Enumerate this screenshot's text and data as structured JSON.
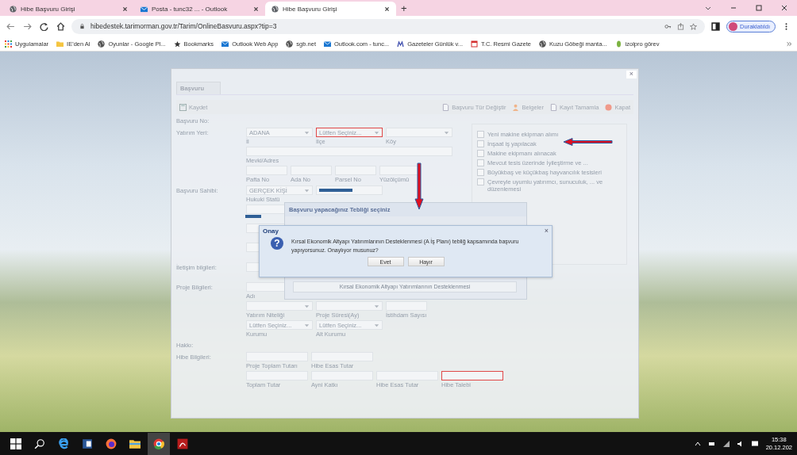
{
  "browser": {
    "tabs": [
      {
        "title": "Hibe Başvuru Girişi",
        "kind": "globe",
        "selected": false
      },
      {
        "title": "Posta - tunc32 ... - Outlook",
        "kind": "mail",
        "selected": false
      },
      {
        "title": "Hibe Başvuru Girişi",
        "kind": "globe",
        "selected": true
      }
    ],
    "new_tab": "+",
    "url": "hibedestek.tarimorman.gov.tr/Tarim/OnlineBasvuru.aspx?tip=3",
    "profile": "Duraklatıldı",
    "bookmarks": [
      {
        "label": "Uygulamalar",
        "kind": "apps"
      },
      {
        "label": "IE'den Al",
        "kind": "folder"
      },
      {
        "label": "Oyunlar - Google Pl...",
        "kind": "globe"
      },
      {
        "label": "Bookmarks",
        "kind": "star"
      },
      {
        "label": "Outlook Web App",
        "kind": "mail"
      },
      {
        "label": "sgb.net",
        "kind": "globe"
      },
      {
        "label": "Outlook.com - tunc...",
        "kind": "mail"
      },
      {
        "label": "Gazeteler Günlük v...",
        "kind": "paper"
      },
      {
        "label": "T.C. Resmi Gazete",
        "kind": "calendar"
      },
      {
        "label": "Kuzu Göbeği manta...",
        "kind": "globe"
      },
      {
        "label": "izolpro görev",
        "kind": "leaf"
      }
    ]
  },
  "form": {
    "close": "×",
    "tab": "Başvuru",
    "save": "Kaydet",
    "actions": [
      {
        "label": "Başvuru Tür Değiştir",
        "kind": "doc"
      },
      {
        "label": "Belgeler",
        "kind": "person"
      },
      {
        "label": "Kayıt Tamamla",
        "kind": "doc"
      },
      {
        "label": "Kapat",
        "kind": "stop"
      }
    ],
    "number_label": "Başvuru No:",
    "sections": [
      {
        "label": "Yatırım Yeri:",
        "lines": [
          {
            "fields": [
              {
                "kind": "select",
                "value": "ADANA",
                "caption": "İl",
                "error": false
              },
              {
                "kind": "select",
                "value": "Lütfen Seçiniz...",
                "caption": "İlçe",
                "error": true
              },
              {
                "kind": "select",
                "caption": "Köy",
                "error": false
              }
            ]
          },
          {
            "fields": [
              {
                "kind": "wide",
                "caption": "Mevki/Adres",
                "error": false
              }
            ]
          },
          {
            "fields": [
              {
                "kind": "text",
                "caption": "Pafta No",
                "error": false
              },
              {
                "kind": "text",
                "caption": "Ada No",
                "error": false
              },
              {
                "kind": "text",
                "caption": "Parsel No",
                "error": false
              },
              {
                "kind": "text",
                "caption": "Yüzölçümü",
                "error": false
              }
            ]
          }
        ]
      },
      {
        "label": "Başvuru Sahibi:",
        "lines": [
          {
            "fields": [
              {
                "kind": "select",
                "value": "GERÇEK KİŞİ",
                "caption": "Hukuki Statü",
                "error": false
              },
              {
                "kind": "redacted",
                "error": false
              }
            ]
          },
          {
            "fields": [
              {
                "kind": "select",
                "error": false
              }
            ]
          },
          {
            "fields": [
              {
                "kind": "select",
                "error": false
              }
            ]
          },
          {
            "fields": [
              {
                "kind": "select",
                "error": false
              }
            ]
          }
        ]
      },
      {
        "label": "İletişim bilgileri:",
        "lines": [
          {
            "fields": [
              {
                "kind": "select",
                "error": false
              }
            ]
          }
        ]
      },
      {
        "label": "Proje Bilgileri:",
        "lines": [
          {
            "fields": [
              {
                "kind": "text",
                "caption": "Adı",
                "error": false
              }
            ]
          },
          {
            "fields": [
              {
                "kind": "select",
                "caption": "Yatırım Niteliği",
                "error": false
              },
              {
                "kind": "select",
                "caption": "Proje Süresi(Ay)",
                "error": false
              },
              {
                "kind": "text",
                "caption": "İstihdam Sayısı",
                "error": false
              }
            ]
          },
          {
            "fields": [
              {
                "kind": "select",
                "value": "Lütfen Seçiniz...",
                "caption": "Kurumu",
                "error": false
              },
              {
                "kind": "select",
                "value": "Lütfen Seçiniz...",
                "caption": "Alt Kurumu",
                "error": false
              }
            ]
          }
        ]
      },
      {
        "label": "Hakkı:"
      },
      {
        "label": "Hibe Bilgileri:",
        "lines": [
          {
            "fields": [
              {
                "kind": "amount",
                "caption": "Proje Toplam Tutarı",
                "error": false
              },
              {
                "kind": "amount",
                "caption": "Hibe Esas Tutar",
                "error": false
              }
            ]
          },
          {
            "fields": [
              {
                "kind": "amount",
                "caption": "Toplam Tutar",
                "error": false
              },
              {
                "kind": "amount",
                "caption": "Ayni Katkı",
                "error": false
              },
              {
                "kind": "amount",
                "caption": "Hibe Esas Tutar",
                "error": false
              },
              {
                "kind": "amount",
                "caption": "Hibe Talebi",
                "error": true
              }
            ]
          }
        ]
      }
    ],
    "checkboxes": [
      {
        "label": "Yeni makine ekipman alımı",
        "checked": false
      },
      {
        "label": "İnşaat iş yapılacak",
        "checked": false
      },
      {
        "label": "Makine ekipmanı alınacak",
        "checked": false
      },
      {
        "label": "Mevcut tesis üzerinde İyileştirme ve ...",
        "checked": false
      },
      {
        "label": "Büyükbaş ve küçükbaş hayvancılık tesisleri",
        "checked": false
      },
      {
        "label": "Çevreyle uyumlu yatırımcı, sunuculuk, ... ve düzenlemesi",
        "checked": false
      }
    ]
  },
  "select_dialog": {
    "title": "Başvuru yapacağınız Tebliği seçiniz",
    "value": "Kırsal Ekonomik Altyapı Yatırımlarının Desteklenmesi"
  },
  "confirm_dialog": {
    "title": "Onay",
    "close": "×",
    "question_mark": "?",
    "message": "Kırsal Ekonomik Altyapı Yatırımlarının Desteklenmesi (A İş Planı) tebliğ kapsamında başvuru yapıyorsunuz. Onaylıyor musunuz?",
    "buttons": [
      "Evet",
      "Hayır"
    ]
  },
  "taskbar": {
    "time": "15:38",
    "date": "20.12.202"
  }
}
